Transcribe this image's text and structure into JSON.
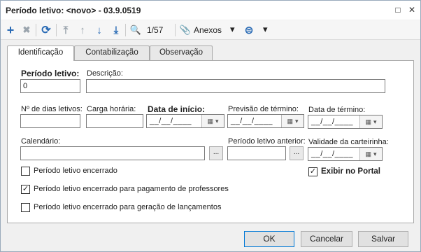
{
  "window": {
    "title": "Período letivo: <novo> - 03.9.0519",
    "restore_glyph": "□",
    "close_glyph": "✕"
  },
  "toolbar": {
    "add_icon": "+",
    "delete_icon": "✖",
    "refresh_icon": "⟳",
    "first_icon": "⤒",
    "prev_icon": "↑",
    "next_icon": "↓",
    "last_icon": "⤓",
    "search_icon": "🔍",
    "record_counter": "1/57",
    "attach_icon": "📎",
    "attachments_label": "Anexos",
    "dropdown_glyph": "▾",
    "more_icon": "⊜",
    "accent_color": "#2a6bb5"
  },
  "tabs": [
    {
      "label": "Identificação",
      "active": true
    },
    {
      "label": "Contabilização",
      "active": false
    },
    {
      "label": "Observação",
      "active": false
    }
  ],
  "form": {
    "periodo_letivo_label": "Período letivo:",
    "periodo_letivo_value": "0",
    "descricao_label": "Descrição:",
    "descricao_value": "",
    "dias_letivos_label": "Nº de dias letivos:",
    "dias_letivos_value": "",
    "carga_horaria_label": "Carga horária:",
    "carga_horaria_value": "",
    "data_inicio_label": "Data de início:",
    "data_inicio_value": "__/__/____",
    "previsao_termino_label": "Previsão de término:",
    "previsao_termino_value": "__/__/____",
    "data_termino_label": "Data de término:",
    "data_termino_value": "__/__/____",
    "calendario_label": "Calendário:",
    "calendario_value": "",
    "periodo_anterior_label": "Período letivo anterior:",
    "periodo_anterior_value": "",
    "validade_carteirinha_label": "Validade da carteirinha:",
    "validade_carteirinha_value": "__/__/____",
    "lookup_button_label": "...",
    "calendar_icon": "▦",
    "calendar_dropdown": "▾"
  },
  "checkboxes": {
    "encerrado": {
      "label": "Período letivo encerrado",
      "checked": false
    },
    "encerrado_pagamento": {
      "label": "Período letivo encerrado para pagamento de professores",
      "checked": true
    },
    "encerrado_lancamentos": {
      "label": "Período letivo encerrado para geração de lançamentos",
      "checked": false
    },
    "exibir_portal": {
      "label": "Exibir no Portal",
      "checked": true
    },
    "check_glyph": "✓"
  },
  "buttons": {
    "ok": "OK",
    "cancel": "Cancelar",
    "save": "Salvar"
  }
}
